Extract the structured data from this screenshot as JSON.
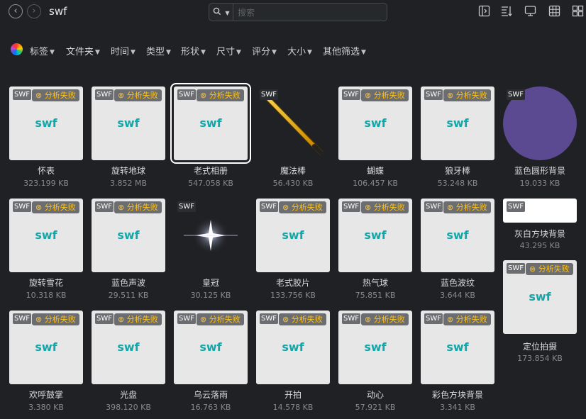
{
  "header": {
    "title": "swf",
    "back_icon": "chevron-left-icon",
    "forward_icon": "chevron-right-icon"
  },
  "search": {
    "placeholder": "搜索",
    "value": ""
  },
  "toolbar": {
    "icons": [
      "sidebar-icon",
      "sort-icon",
      "monitor-icon",
      "grid-icon",
      "layout-icon"
    ]
  },
  "filters": [
    {
      "label": "标签"
    },
    {
      "label": "文件夹"
    },
    {
      "label": "时间"
    },
    {
      "label": "类型"
    },
    {
      "label": "形状"
    },
    {
      "label": "尺寸"
    },
    {
      "label": "评分"
    },
    {
      "label": "大小"
    },
    {
      "label": "其他筛选"
    }
  ],
  "badges": {
    "type": "SWF",
    "fail": "⊗ 分析失败",
    "placeholder": "swf"
  },
  "colors": {
    "background": "#1f2124",
    "accent_teal": "#15a6a8",
    "warning_yellow": "#ffc21a",
    "circle_purple": "#5b4a92"
  },
  "items": [
    {
      "name": "怀表",
      "size": "323.199 KB"
    },
    {
      "name": "旋转地球",
      "size": "3.852 MB"
    },
    {
      "name": "老式相册",
      "size": "547.058 KB",
      "selected": true
    },
    {
      "name": "魔法棒",
      "size": "56.430 KB"
    },
    {
      "name": "蝴蝶",
      "size": "106.457 KB"
    },
    {
      "name": "狼牙棒",
      "size": "53.248 KB"
    },
    {
      "name": "蓝色圆形背景",
      "size": "19.033 KB"
    },
    {
      "name": "旋转雪花",
      "size": "10.318 KB"
    },
    {
      "name": "蓝色声波",
      "size": "29.511 KB"
    },
    {
      "name": "皇冠",
      "size": "30.125 KB"
    },
    {
      "name": "老式胶片",
      "size": "133.756 KB"
    },
    {
      "name": "热气球",
      "size": "75.851 KB"
    },
    {
      "name": "蓝色波纹",
      "size": "3.644 KB"
    },
    {
      "name": "灰白方块背景",
      "size": "43.295 KB"
    },
    {
      "name": "欢呼鼓掌",
      "size": "3.380 KB"
    },
    {
      "name": "光盘",
      "size": "398.120 KB"
    },
    {
      "name": "乌云落雨",
      "size": "16.763 KB"
    },
    {
      "name": "开拍",
      "size": "14.578 KB"
    },
    {
      "name": "动心",
      "size": "57.921 KB"
    },
    {
      "name": "彩色方块背景",
      "size": "3.341 KB"
    },
    {
      "name": "定位拍摄",
      "size": "173.854 KB"
    }
  ]
}
